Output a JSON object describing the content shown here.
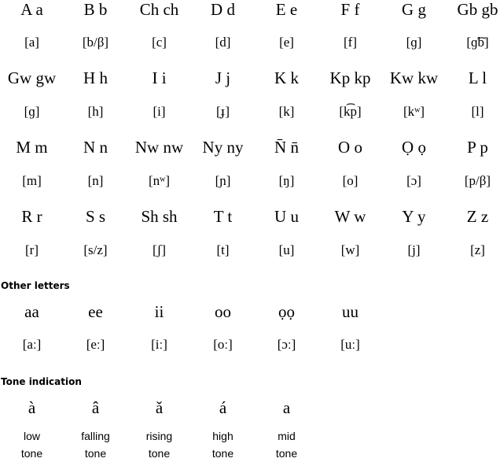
{
  "alphabet": {
    "rows": [
      [
        {
          "letter": "A a",
          "ipa": "[a]"
        },
        {
          "letter": "B b",
          "ipa": "[b/β]"
        },
        {
          "letter": "Ch ch",
          "ipa": "[c]"
        },
        {
          "letter": "D d",
          "ipa": "[d]"
        },
        {
          "letter": "E e",
          "ipa": "[e]"
        },
        {
          "letter": "F f",
          "ipa": "[f]"
        },
        {
          "letter": "G g",
          "ipa": "[ɡ]"
        },
        {
          "letter": "Gb gb",
          "ipa": "[ɡ͡b]"
        }
      ],
      [
        {
          "letter": "Gw gw",
          "ipa": "[ɡ]"
        },
        {
          "letter": "H h",
          "ipa": "[h]"
        },
        {
          "letter": "I i",
          "ipa": "[i]"
        },
        {
          "letter": "J j",
          "ipa": "[ɟ]"
        },
        {
          "letter": "K k",
          "ipa": "[k]"
        },
        {
          "letter": "Kp kp",
          "ipa": "[k͡p]"
        },
        {
          "letter": "Kw kw",
          "ipa": "[kʷ]"
        },
        {
          "letter": "L l",
          "ipa": "[l]"
        }
      ],
      [
        {
          "letter": "M m",
          "ipa": "[m]"
        },
        {
          "letter": "N n",
          "ipa": "[n]"
        },
        {
          "letter": "Nw nw",
          "ipa": "[nʷ]"
        },
        {
          "letter": "Ny ny",
          "ipa": "[ɲ]"
        },
        {
          "letter": "N̄ n̄",
          "ipa": "[ŋ]"
        },
        {
          "letter": "O o",
          "ipa": "[o]"
        },
        {
          "letter": "Ọ ọ",
          "ipa": "[ɔ]"
        },
        {
          "letter": "P p",
          "ipa": "[p/β]"
        }
      ],
      [
        {
          "letter": "R r",
          "ipa": "[r]"
        },
        {
          "letter": "S s",
          "ipa": "[s/z]"
        },
        {
          "letter": "Sh sh",
          "ipa": "[ʃ]"
        },
        {
          "letter": "T t",
          "ipa": "[t]"
        },
        {
          "letter": "U u",
          "ipa": "[u]"
        },
        {
          "letter": "W w",
          "ipa": "[w]"
        },
        {
          "letter": "Y y",
          "ipa": "[j]"
        },
        {
          "letter": "Z z",
          "ipa": "[z]"
        }
      ]
    ]
  },
  "other_letters": {
    "heading": "Other letters",
    "items": [
      {
        "letter": "aa",
        "ipa": "[aː]"
      },
      {
        "letter": "ee",
        "ipa": "[eː]"
      },
      {
        "letter": "ii",
        "ipa": "[iː]"
      },
      {
        "letter": "oo",
        "ipa": "[oː]"
      },
      {
        "letter": "ọọ",
        "ipa": "[ɔː]"
      },
      {
        "letter": "uu",
        "ipa": "[uː]"
      }
    ]
  },
  "tone_indication": {
    "heading": "Tone indication",
    "items": [
      {
        "mark": "à",
        "label1": "low",
        "label2": "tone"
      },
      {
        "mark": "â",
        "label1": "falling",
        "label2": "tone"
      },
      {
        "mark": "ǎ",
        "label1": "rising",
        "label2": "tone"
      },
      {
        "mark": "á",
        "label1": "high",
        "label2": "tone"
      },
      {
        "mark": "a",
        "label1": "mid",
        "label2": "tone"
      }
    ]
  }
}
